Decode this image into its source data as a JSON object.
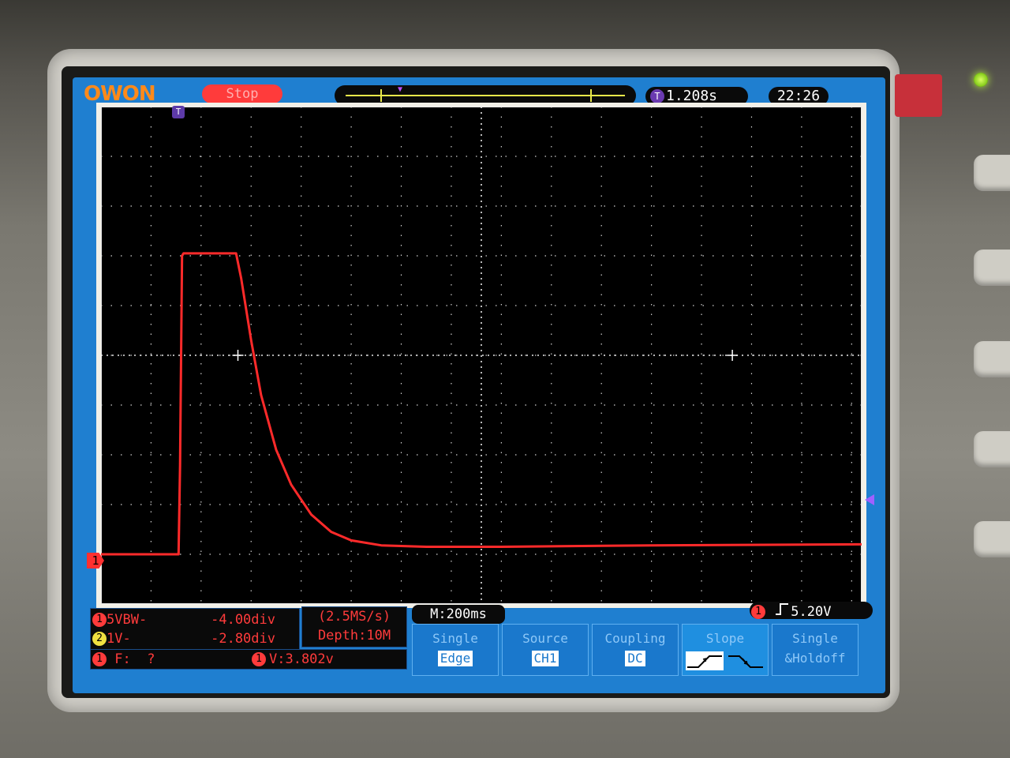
{
  "header": {
    "brand": "OWON",
    "run_status": "Stop",
    "trigger_time": "1.208s",
    "trigger_badge": "T",
    "clock": "22:26"
  },
  "markers": {
    "trigger_position": "T",
    "ch1_ground": "1"
  },
  "channels": [
    {
      "badge": "1",
      "coupling": "5VBW-",
      "offset": "-4.00div",
      "color": "#ff3b3b"
    },
    {
      "badge": "2",
      "coupling": "1V-",
      "offset": "-2.80div",
      "color": "#f0e040"
    }
  ],
  "acquisition": {
    "sample_rate": "(2.5MS/s)",
    "depth": "Depth:10M"
  },
  "measurements": {
    "freq_badge": "1",
    "freq": "F:  ?",
    "volt_badge": "1",
    "volt": "V:3.802v"
  },
  "timebase": "M:200ms",
  "trigger_level": {
    "badge": "1",
    "value": "5.20V"
  },
  "menu": {
    "mode": {
      "label": "Single",
      "value": "Edge"
    },
    "source": {
      "label": "Source",
      "value": "CH1"
    },
    "coupling": {
      "label": "Coupling",
      "value": "DC"
    },
    "slope": {
      "label": "Slope"
    },
    "holdoff": {
      "label_line1": "Single",
      "label_line2": "&Holdoff"
    }
  },
  "waveform": {
    "color": "#ff2a2a",
    "samples_div": [
      [
        0.0,
        -4.0
      ],
      [
        1.55,
        -4.0
      ],
      [
        1.58,
        -2.2
      ],
      [
        1.62,
        2.0
      ],
      [
        1.65,
        2.05
      ],
      [
        2.7,
        2.05
      ],
      [
        2.8,
        1.55
      ],
      [
        3.0,
        0.3
      ],
      [
        3.2,
        -0.8
      ],
      [
        3.5,
        -1.9
      ],
      [
        3.8,
        -2.6
      ],
      [
        4.2,
        -3.2
      ],
      [
        4.6,
        -3.55
      ],
      [
        5.0,
        -3.72
      ],
      [
        5.6,
        -3.82
      ],
      [
        6.5,
        -3.85
      ],
      [
        8.0,
        -3.85
      ],
      [
        11.0,
        -3.82
      ],
      [
        15.2,
        -3.8
      ]
    ]
  }
}
